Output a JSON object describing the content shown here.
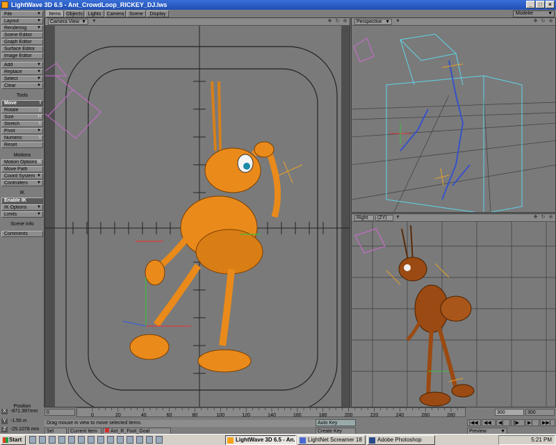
{
  "window": {
    "title": "LightWave 3D 6.5 - Ant_CrowdLoop_RICKEY_DJ.lws"
  },
  "tabs": [
    "Items",
    "Objects",
    "Lights",
    "Camera",
    "Scene",
    "Display"
  ],
  "modeler_label": "Modeler",
  "left_panel": {
    "menus": [
      "File",
      "Layout",
      "Rendering",
      "Scene Editor",
      "Graph Editor",
      "Surface Editor",
      "Image Editor",
      "Add",
      "Replace",
      "Select",
      "Clear"
    ],
    "tools_header": "Tools",
    "tools": [
      {
        "label": "Move",
        "key": "t"
      },
      {
        "label": "Rotate",
        "key": "y"
      },
      {
        "label": "Size",
        "key": "H"
      },
      {
        "label": "Stretch",
        "key": "h"
      },
      {
        "label": "Pivot",
        "key": ""
      },
      {
        "label": "Numeric",
        "key": "n"
      },
      {
        "label": "Reset",
        "key": ""
      }
    ],
    "motions_header": "Motions",
    "motions": [
      "Motion Options",
      "Move Path",
      "Coord System",
      "Controllers"
    ],
    "ik_header": "IK",
    "ik": [
      "Enable IK",
      "IK Options",
      "Limits"
    ],
    "scene_info": "Scene Info",
    "comments": "Comments"
  },
  "viewports": {
    "main": {
      "view": "Camera View"
    },
    "top_right": {
      "view": "Perspective"
    },
    "bottom_right": {
      "view": "Right",
      "axes": "(ZY)"
    }
  },
  "position": {
    "label": "Position",
    "x": "-871.397mm",
    "y": "-1.55 m",
    "z": "-25.1078 mm"
  },
  "timeline": {
    "ticks": [
      "0",
      "20",
      "40",
      "60",
      "80",
      "100",
      "120",
      "140",
      "160",
      "180",
      "200",
      "220",
      "240",
      "260",
      "280"
    ],
    "start": "0",
    "current": "300",
    "end": "300"
  },
  "status_message": "Drag mouse in view to move selected items.",
  "bottom_controls": {
    "sel_label": "Sel",
    "current_item_label": "Current Item",
    "current_item_value": "Ant_R_Foot_Goal",
    "auto_key": "Auto Key",
    "create_key": "Create Key",
    "preview": "Preview",
    "playback_glyphs": [
      "|◀◀",
      "◀◀",
      "◀|",
      "||▶",
      "▶|",
      "▶▶|"
    ]
  },
  "taskbar": {
    "start_label": "Start",
    "tasks": [
      "LightWave 3D 6.5 - An...",
      "LightNet Screamer 18",
      "Adobe Photoshop"
    ],
    "clock": "5:21 PM"
  },
  "colors": {
    "ant_orange": "#e98a1a",
    "viewport_bg": "#7a7a7a",
    "bone_cyan": "#5fd6ec",
    "camera_magenta": "#d06bd6",
    "bone_blue": "#3652c8"
  }
}
